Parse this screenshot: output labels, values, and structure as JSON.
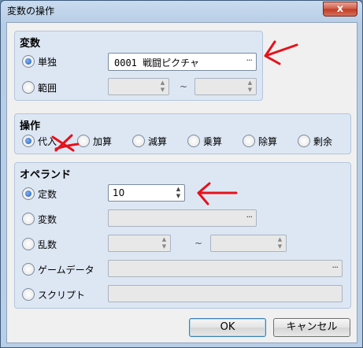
{
  "window": {
    "title": "変数の操作",
    "close_label": "x"
  },
  "variable_group": {
    "title": "変数",
    "single": {
      "label": "単独",
      "selected": true,
      "value": "0001 戦闘ピクチャ",
      "button": "···"
    },
    "range": {
      "label": "範囲",
      "selected": false,
      "separator": "~"
    }
  },
  "operation_group": {
    "title": "操作",
    "options": [
      {
        "label": "代入",
        "selected": true
      },
      {
        "label": "加算",
        "selected": false
      },
      {
        "label": "減算",
        "selected": false
      },
      {
        "label": "乗算",
        "selected": false
      },
      {
        "label": "除算",
        "selected": false
      },
      {
        "label": "剰余",
        "selected": false
      }
    ]
  },
  "operand_group": {
    "title": "オペランド",
    "constant": {
      "label": "定数",
      "selected": true,
      "value": "10"
    },
    "variable": {
      "label": "変数",
      "selected": false,
      "button": "···"
    },
    "random": {
      "label": "乱数",
      "selected": false,
      "separator": "~"
    },
    "game_data": {
      "label": "ゲームデータ",
      "selected": false,
      "button": "···"
    },
    "script": {
      "label": "スクリプト",
      "selected": false
    }
  },
  "buttons": {
    "ok": "OK",
    "cancel": "キャンセル"
  },
  "annotations": {
    "color": "#e8101a"
  }
}
